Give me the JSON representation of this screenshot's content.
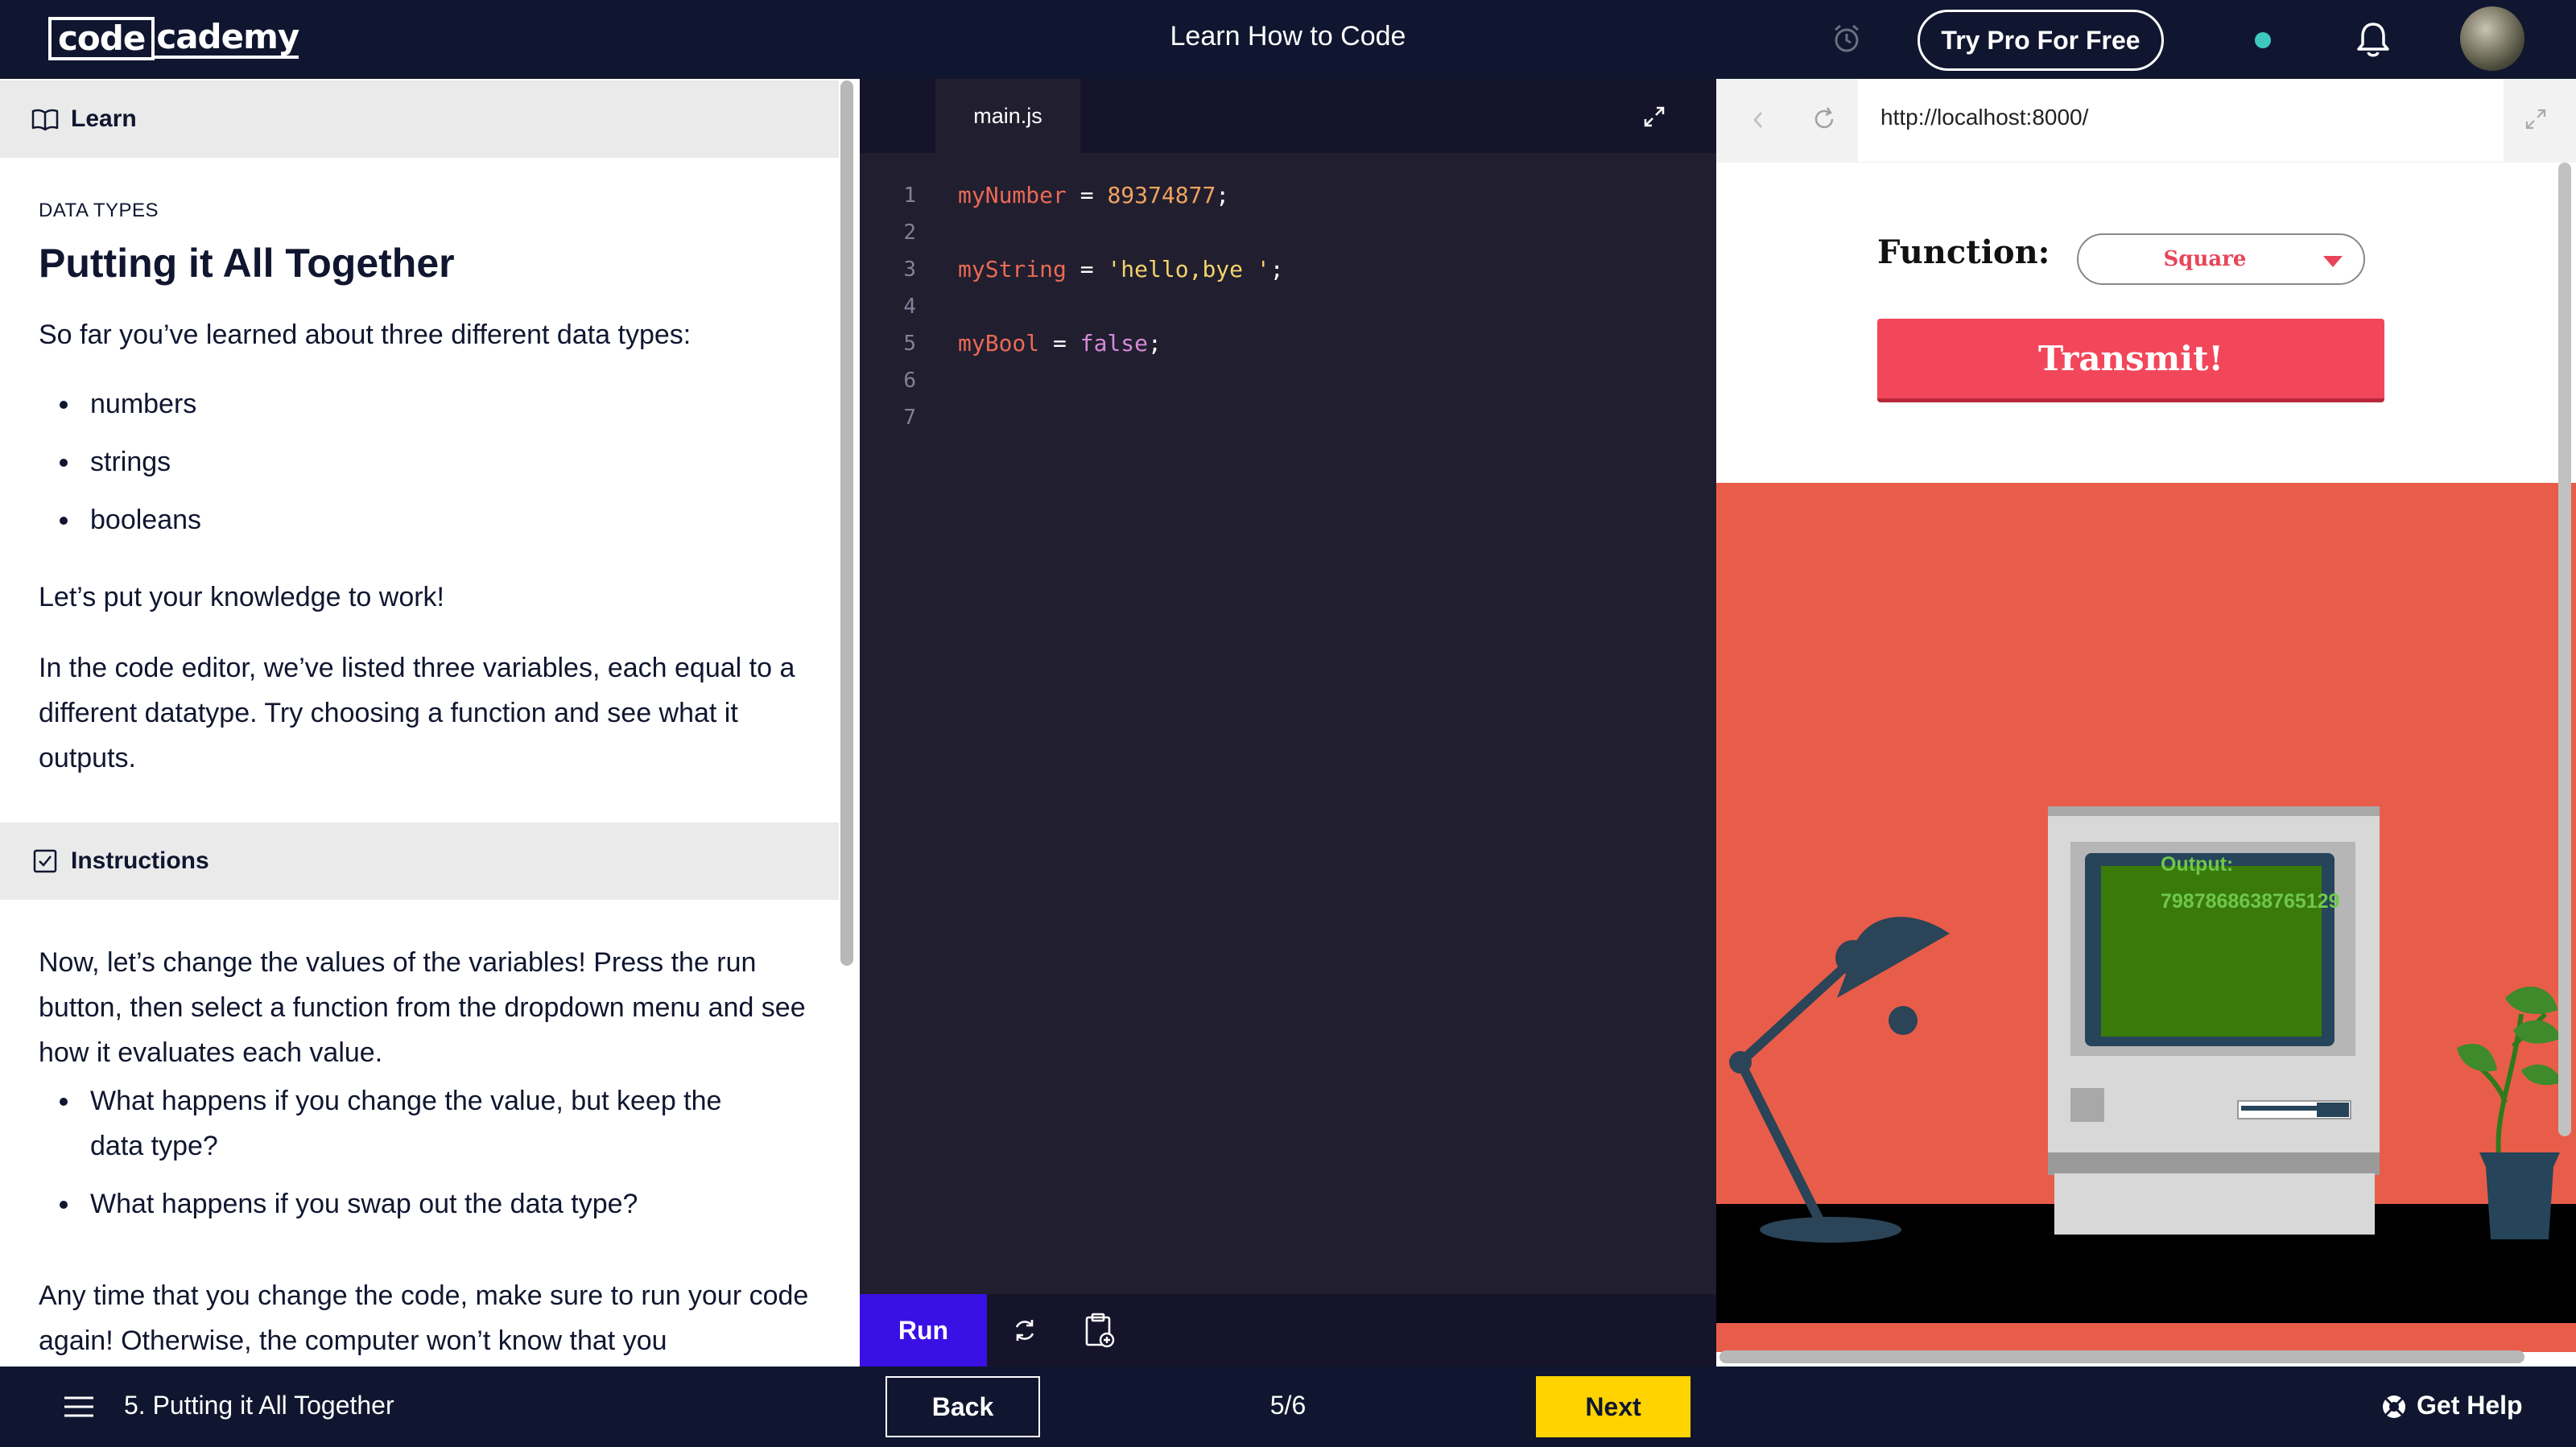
{
  "app": {
    "logo_code": "code",
    "logo_rest": "cademy",
    "title": "Learn How to Code",
    "try_pro_label": "Try Pro For Free",
    "status_dot_color": "#3fc8c0"
  },
  "learn_panel": {
    "header_label": "Learn",
    "kicker": "DATA TYPES",
    "title": "Putting it All Together",
    "intro": "So far you’ve learned about three different data types:",
    "types": [
      "numbers",
      "strings",
      "booleans"
    ],
    "p2": "Let’s put your knowledge to work!",
    "p3": "In the code editor, we’ve listed three variables, each equal to a different datatype. Try choosing a function and see what it outputs."
  },
  "instructions_panel": {
    "header_label": "Instructions",
    "p1": "Now, let’s change the values of the variables! Press the run button, then select a function from the dropdown menu and see how it evaluates each value.",
    "questions": [
      "What happens if you change the value, but keep the data type?",
      "What happens if you swap out the data type?"
    ],
    "p2": "Any time that you change the code, make sure to run your code again! Otherwise, the computer won’t know that you"
  },
  "editor": {
    "tab_label": "main.js",
    "line_numbers": [
      "1",
      "2",
      "3",
      "4",
      "5",
      "6",
      "7"
    ],
    "line1": {
      "var": "myNumber",
      "op": " = ",
      "val": "89374877",
      "end": ";"
    },
    "line3": {
      "var": "myString",
      "op": " = ",
      "val": "'hello,bye '",
      "end": ";"
    },
    "line5": {
      "var": "myBool",
      "op": " = ",
      "val": "false",
      "end": ";"
    },
    "run_label": "Run"
  },
  "browser": {
    "url": "http://localhost:8000/",
    "function_label": "Function:",
    "function_selected": "Square",
    "transmit_label": "Transmit!",
    "output_label": "Output:",
    "output_value": "7987868638765129",
    "colors": {
      "wall": "#e85d4a",
      "desk": "#000000",
      "screen": "#3a7a0a",
      "button": "#f2475a"
    }
  },
  "bottom": {
    "lesson_label": "5. Putting it All Together",
    "back_label": "Back",
    "progress": "5/6",
    "next_label": "Next",
    "help_label": "Get Help"
  }
}
